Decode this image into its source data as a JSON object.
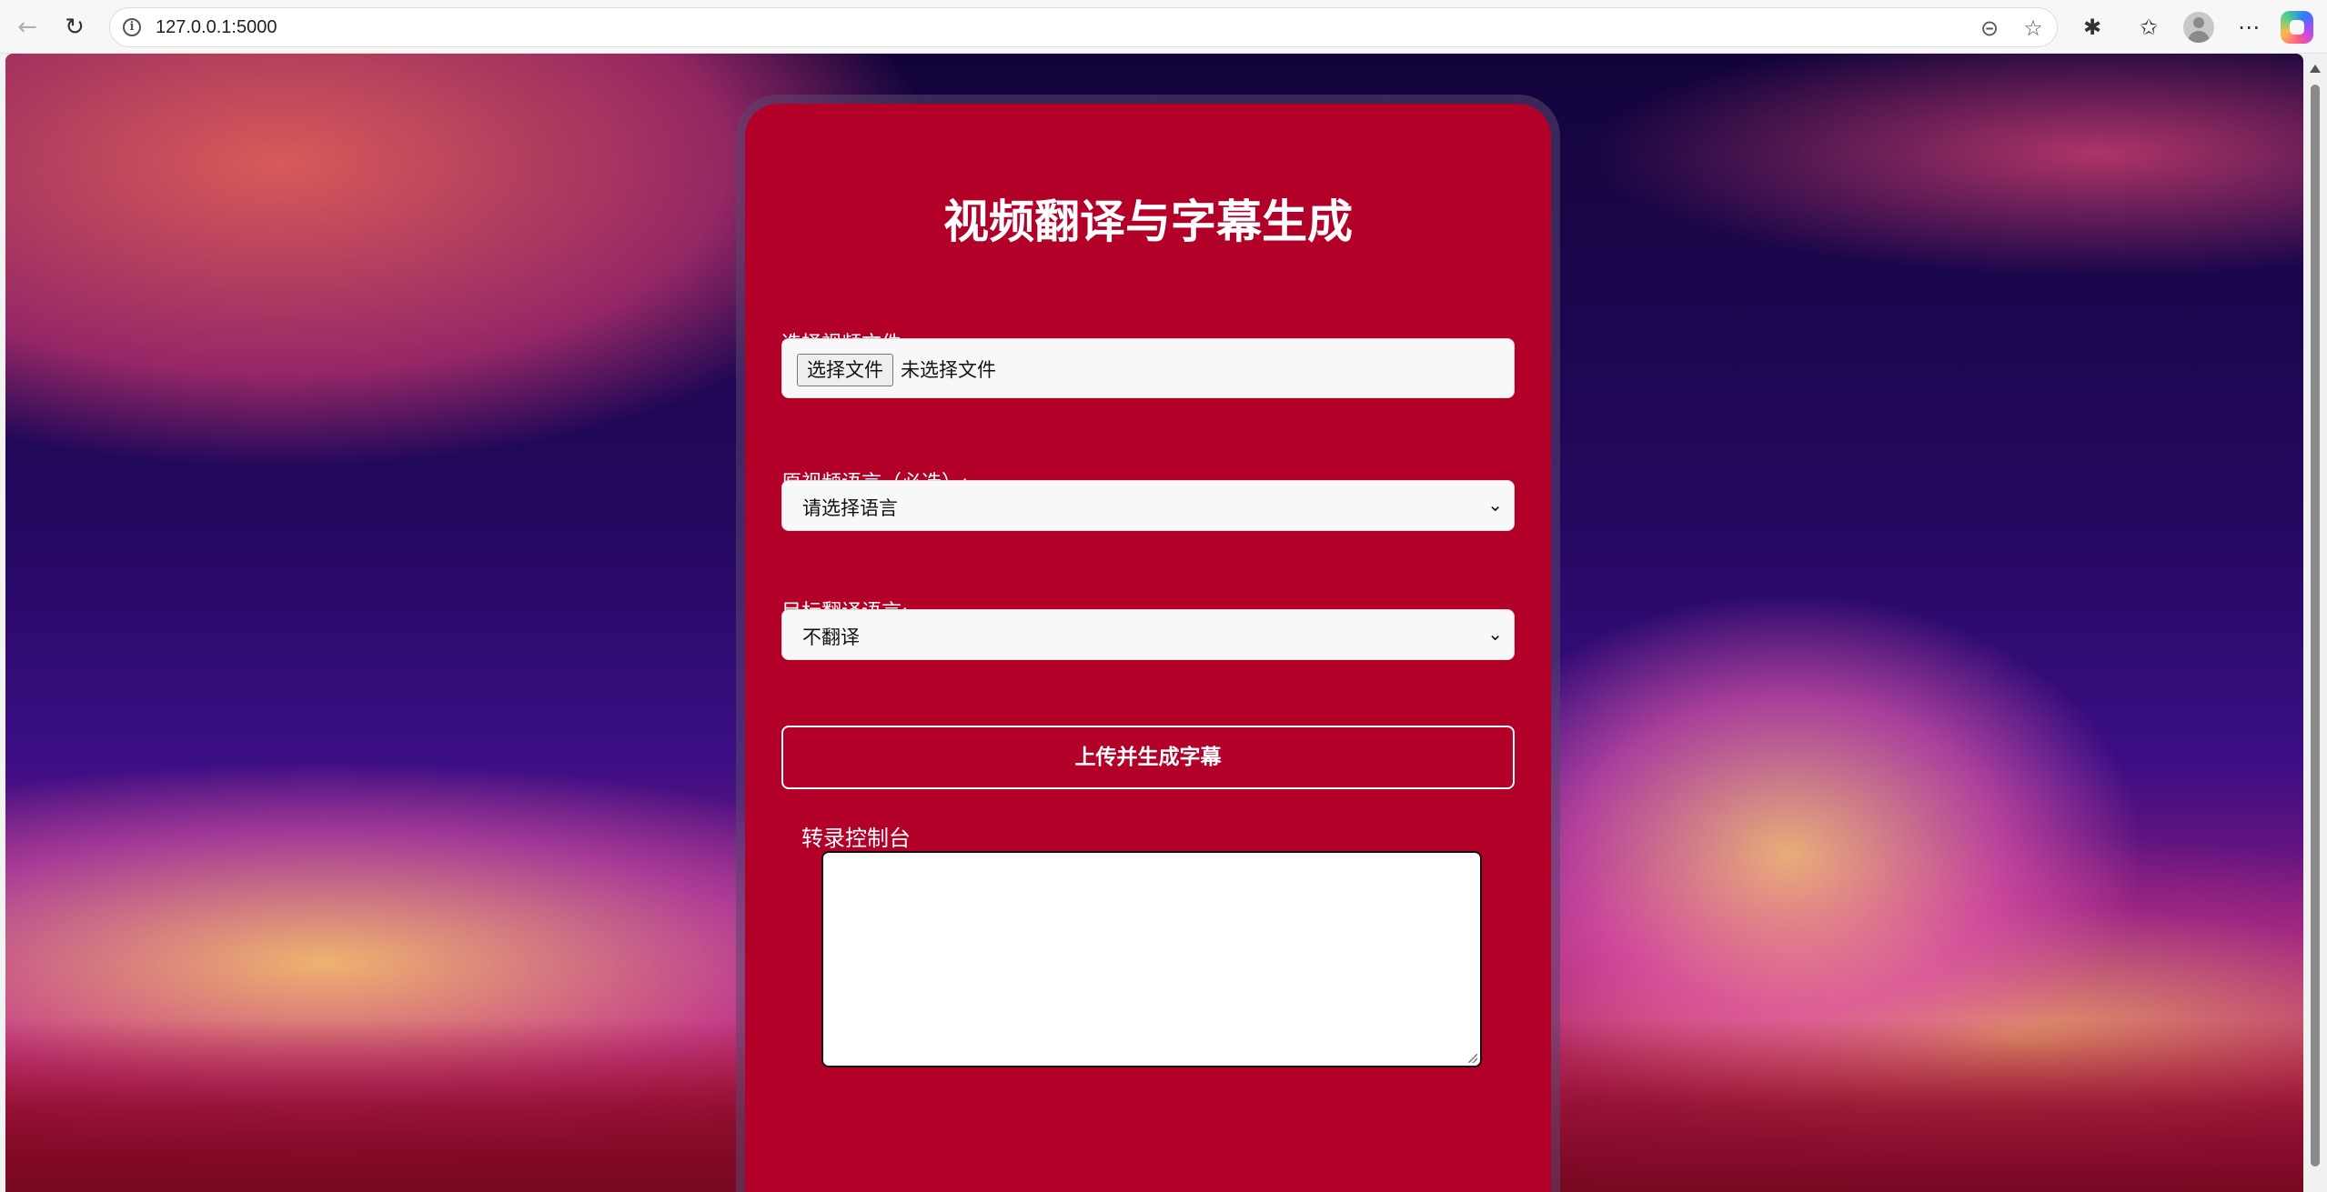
{
  "browser": {
    "url": "127.0.0.1:5000",
    "icons": {
      "back": "back-arrow-icon",
      "reload": "reload-icon",
      "info": "info-icon",
      "zoom": "zoom-out-icon",
      "favorite": "star-icon",
      "extensions": "puzzle-icon",
      "favorites": "favorites-icon",
      "profile": "avatar",
      "more": "more-icon",
      "copilot": "copilot-icon"
    }
  },
  "form": {
    "title": "视频翻译与字幕生成",
    "file_label": "选择视频文件:",
    "file_button": "选择文件",
    "file_status": "未选择文件",
    "source_lang_label": "原视频语言（必选）:",
    "source_lang_value": "请选择语言",
    "target_lang_label": "目标翻译语言:",
    "target_lang_value": "不翻译",
    "submit_label": "上传并生成字幕",
    "console_title": "转录控制台",
    "console_text": ""
  },
  "colors": {
    "card": "#b30029",
    "text": "#ffffff"
  }
}
